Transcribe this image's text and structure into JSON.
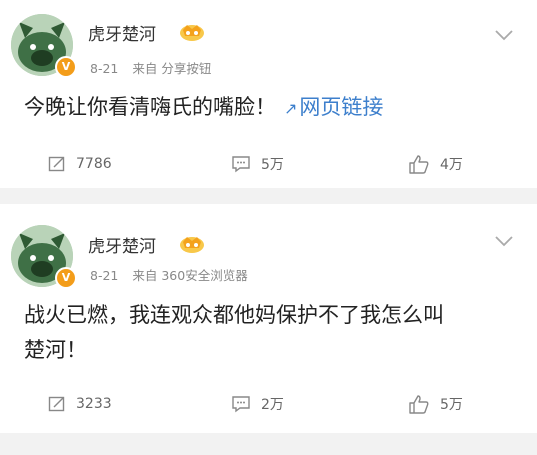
{
  "posts": [
    {
      "author": "虎牙楚河",
      "time": "8-21",
      "source": "来自 分享按钮",
      "text": "今晚让你看清嗨氏的嘴脸！",
      "link_label": "网页链接",
      "reposts": "7786",
      "comments": "5万",
      "likes": "4万"
    },
    {
      "author": "虎牙楚河",
      "time": "8-21",
      "source": "来自 360安全浏览器",
      "text_line1": "战火已燃，我连观众都他妈保护不了我怎么叫",
      "text_line2": "楚河！",
      "reposts": "3233",
      "comments": "2万",
      "likes": "5万"
    }
  ],
  "icons": {
    "avatar": "pig-avatar",
    "verified": "v-badge-icon",
    "member": "crown-icon",
    "menu": "chevron-down-icon",
    "repost": "repost-icon",
    "comment": "comment-icon",
    "like": "thumbs-up-icon",
    "link": "link-icon"
  },
  "colors": {
    "link": "#3d7fcc",
    "badge": "#f39d1a",
    "background": "#f2f2f2"
  }
}
